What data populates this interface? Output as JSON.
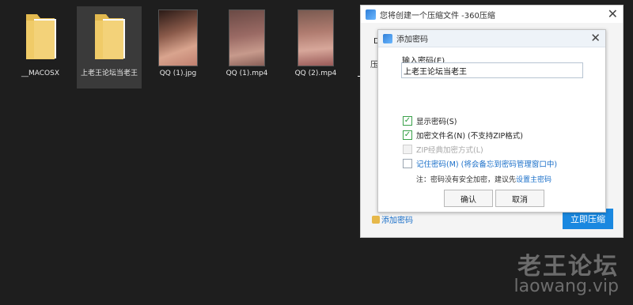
{
  "desktop": {
    "files": [
      {
        "label": "__MACOSX",
        "icon": "folder-icon"
      },
      {
        "label": "上老王论坛当老王",
        "icon": "folder-icon"
      },
      {
        "label": "QQ (1).jpg",
        "icon": "image-thumbnail"
      },
      {
        "label": "QQ (1).mp4",
        "icon": "video-thumbnail"
      },
      {
        "label": "QQ (2).mp4",
        "icon": "video-thumbnail"
      }
    ]
  },
  "outer_dialog": {
    "title": "您将创建一个压缩文件 -360压缩",
    "close": "✕",
    "frag_d": "D",
    "frag_ya": "压",
    "add_password_link": "添加密码",
    "compress_button": "立即压缩"
  },
  "inner_dialog": {
    "title": "添加密码",
    "close": "✕",
    "password_label": "输入密码(E)",
    "password_value": "上老王论坛当老王",
    "options": {
      "show_password": "显示密码(S)",
      "encrypt_filenames": "加密文件名(N) (不支持ZIP格式)",
      "zip_classic": "ZIP经典加密方式(L)",
      "remember_password": "记住密码(M) (将会备忘到密码管理窗口中)"
    },
    "note_prefix": "注：密码没有安全加密，建议先",
    "note_link": "设置主密码",
    "ok_button": "确认",
    "cancel_button": "取消"
  },
  "watermark": {
    "title": "老王论坛",
    "url": "laowang.vip"
  },
  "colors": {
    "desktop_bg": "#1e1e1e",
    "accent": "#1a88e0",
    "link": "#1a6fc9",
    "check": "#2a9a3c"
  }
}
